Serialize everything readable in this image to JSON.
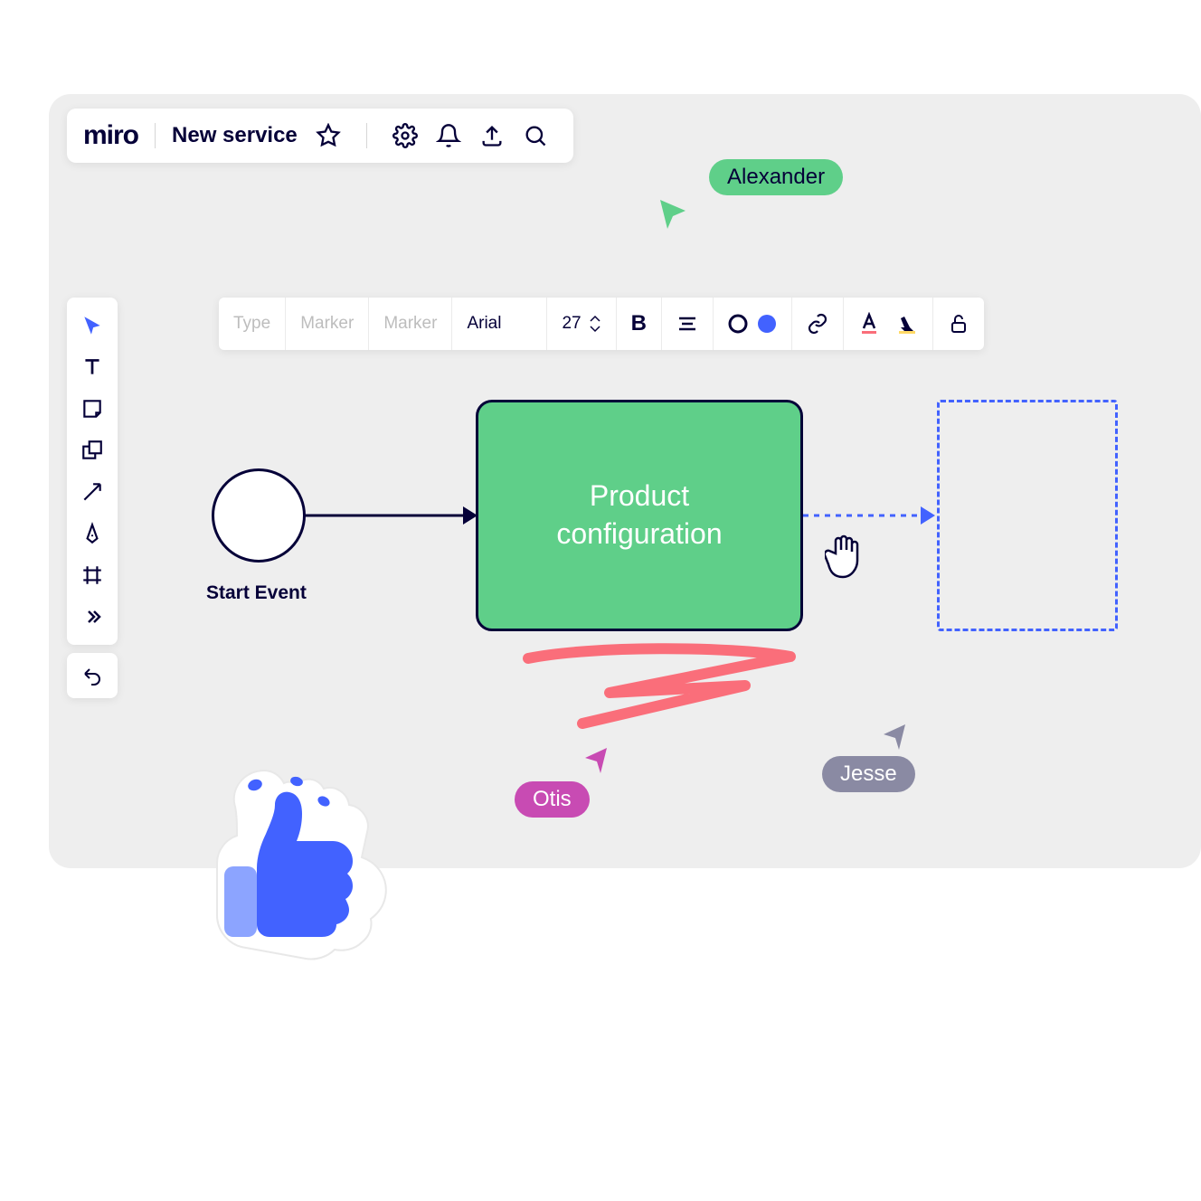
{
  "header": {
    "logo": "miro",
    "board_title": "New service"
  },
  "format_bar": {
    "type_label": "Type",
    "marker1_label": "Marker",
    "marker2_label": "Marker",
    "font_label": "Arial",
    "font_size": "27"
  },
  "collaborators": {
    "alexander": {
      "name": "Alexander",
      "color": "#5fcf89"
    },
    "otis": {
      "name": "Otis",
      "color": "#c84bb3"
    },
    "jesse": {
      "name": "Jesse",
      "color": "#8a8aa3"
    }
  },
  "canvas": {
    "start_label": "Start Event",
    "product_box": "Product\nconfiguration"
  },
  "colors": {
    "primary": "#050038",
    "accent_blue": "#4262ff",
    "green": "#5fcf89",
    "pink": "#fa6e7a"
  }
}
